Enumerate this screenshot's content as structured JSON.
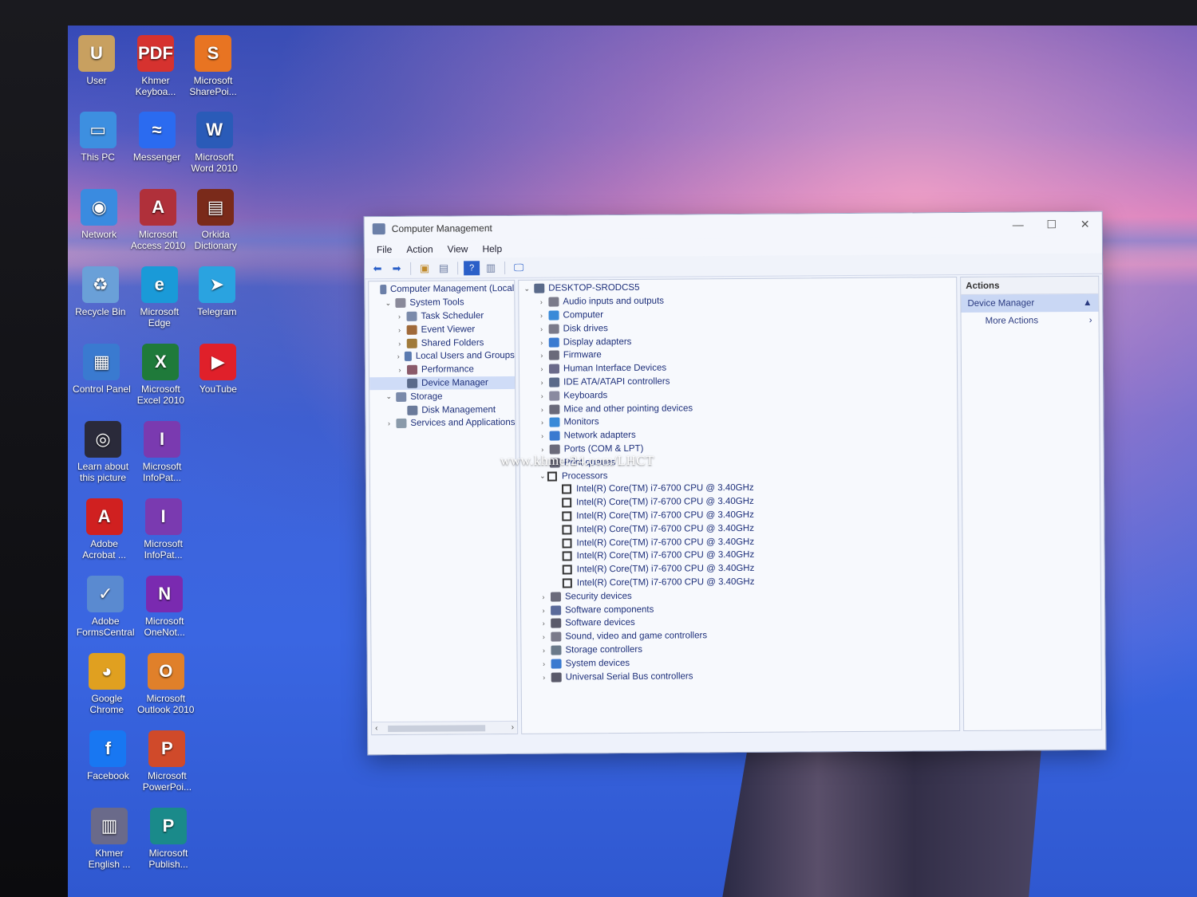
{
  "desktop_icons": [
    {
      "label": "User",
      "color": "#c8a060",
      "glyph": "U"
    },
    {
      "label": "Khmer Keyboa...",
      "color": "#d6322f",
      "glyph": "PDF"
    },
    {
      "label": "Microsoft SharePoi...",
      "color": "#e87422",
      "glyph": "S"
    },
    {
      "label": "This PC",
      "color": "#3d8fe0",
      "glyph": "▭"
    },
    {
      "label": "Messenger",
      "color": "#2b6bf0",
      "glyph": "≈"
    },
    {
      "label": "Microsoft Word 2010",
      "color": "#2a5bb8",
      "glyph": "W"
    },
    {
      "label": "Network",
      "color": "#3a8be0",
      "glyph": "◉"
    },
    {
      "label": "Microsoft Access 2010",
      "color": "#b0303a",
      "glyph": "A"
    },
    {
      "label": "Orkida Dictionary",
      "color": "#7a2a1a",
      "glyph": "▤"
    },
    {
      "label": "Recycle Bin",
      "color": "#6aa0d8",
      "glyph": "♻"
    },
    {
      "label": "Microsoft Edge",
      "color": "#1a9ad8",
      "glyph": "e"
    },
    {
      "label": "Telegram",
      "color": "#2aa3e0",
      "glyph": "➤"
    },
    {
      "label": "Control Panel",
      "color": "#3a7ad0",
      "glyph": "▦"
    },
    {
      "label": "Microsoft Excel 2010",
      "color": "#1f7a3a",
      "glyph": "X"
    },
    {
      "label": "YouTube",
      "color": "#e0202a",
      "glyph": "▶"
    },
    {
      "label": "Learn about this picture",
      "color": "#2a2a3a",
      "glyph": "◎"
    },
    {
      "label": "Microsoft InfoPat...",
      "color": "#7a3ab0",
      "glyph": "I"
    },
    {
      "label": "Adobe Acrobat ...",
      "color": "#d02020",
      "glyph": "A"
    },
    {
      "label": "Microsoft InfoPat...",
      "color": "#7a3ab0",
      "glyph": "I"
    },
    {
      "label": "Adobe FormsCentral",
      "color": "#5a8ad0",
      "glyph": "✓"
    },
    {
      "label": "Microsoft OneNot...",
      "color": "#7a2ab0",
      "glyph": "N"
    },
    {
      "label": "Google Chrome",
      "color": "#e0a020",
      "glyph": "◕"
    },
    {
      "label": "Microsoft Outlook 2010",
      "color": "#e0802a",
      "glyph": "O"
    },
    {
      "label": "Facebook",
      "color": "#1877f2",
      "glyph": "f"
    },
    {
      "label": "Microsoft PowerPoi...",
      "color": "#d04a2a",
      "glyph": "P"
    },
    {
      "label": "Khmer English ...",
      "color": "#6a6a8a",
      "glyph": "▥"
    },
    {
      "label": "Microsoft Publish...",
      "color": "#1a8a8a",
      "glyph": "P"
    }
  ],
  "window": {
    "title": "Computer Management",
    "controls": {
      "minimize": "—",
      "maximize": "☐",
      "close": "✕"
    },
    "menu": [
      "File",
      "Action",
      "View",
      "Help"
    ]
  },
  "left_tree": [
    {
      "label": "Computer Management (Local",
      "indent": 0,
      "chev": "",
      "color": "#6b7fa8"
    },
    {
      "label": "System Tools",
      "indent": 1,
      "chev": "v",
      "color": "#8a8a9a"
    },
    {
      "label": "Task Scheduler",
      "indent": 2,
      "chev": ">",
      "color": "#7a8aaa"
    },
    {
      "label": "Event Viewer",
      "indent": 2,
      "chev": ">",
      "color": "#a06a3a"
    },
    {
      "label": "Shared Folders",
      "indent": 2,
      "chev": ">",
      "color": "#a07a3a"
    },
    {
      "label": "Local Users and Groups",
      "indent": 2,
      "chev": ">",
      "color": "#5a7ab0"
    },
    {
      "label": "Performance",
      "indent": 2,
      "chev": ">",
      "color": "#8a5a6a"
    },
    {
      "label": "Device Manager",
      "indent": 2,
      "chev": "",
      "color": "#5a6a8a",
      "selected": true
    },
    {
      "label": "Storage",
      "indent": 1,
      "chev": "v",
      "color": "#7a8aaa"
    },
    {
      "label": "Disk Management",
      "indent": 2,
      "chev": "",
      "color": "#6a7a9a"
    },
    {
      "label": "Services and Applications",
      "indent": 1,
      "chev": ">",
      "color": "#8a9aaa"
    }
  ],
  "device_tree": {
    "root": "DESKTOP-SRODCS5",
    "categories_before": [
      {
        "label": "Audio inputs and outputs",
        "color": "#7a7a8a"
      },
      {
        "label": "Computer",
        "color": "#3a8ad8"
      },
      {
        "label": "Disk drives",
        "color": "#7a7a8a"
      },
      {
        "label": "Display adapters",
        "color": "#3a7ad0"
      },
      {
        "label": "Firmware",
        "color": "#6a6a7a"
      },
      {
        "label": "Human Interface Devices",
        "color": "#6a6a8a"
      },
      {
        "label": "IDE ATA/ATAPI controllers",
        "color": "#5a6a8a"
      },
      {
        "label": "Keyboards",
        "color": "#8a8aa0"
      },
      {
        "label": "Mice and other pointing devices",
        "color": "#6a6a7a"
      },
      {
        "label": "Monitors",
        "color": "#3a8ad8"
      },
      {
        "label": "Network adapters",
        "color": "#3a7ad0"
      },
      {
        "label": "Ports (COM & LPT)",
        "color": "#6a6a7a"
      },
      {
        "label": "Print queues",
        "color": "#6a6a7a"
      }
    ],
    "processors_label": "Processors",
    "processors": [
      "Intel(R) Core(TM) i7-6700 CPU @ 3.40GHz",
      "Intel(R) Core(TM) i7-6700 CPU @ 3.40GHz",
      "Intel(R) Core(TM) i7-6700 CPU @ 3.40GHz",
      "Intel(R) Core(TM) i7-6700 CPU @ 3.40GHz",
      "Intel(R) Core(TM) i7-6700 CPU @ 3.40GHz",
      "Intel(R) Core(TM) i7-6700 CPU @ 3.40GHz",
      "Intel(R) Core(TM) i7-6700 CPU @ 3.40GHz",
      "Intel(R) Core(TM) i7-6700 CPU @ 3.40GHz"
    ],
    "categories_after": [
      {
        "label": "Security devices",
        "color": "#6a6a7a"
      },
      {
        "label": "Software components",
        "color": "#5a6a9a"
      },
      {
        "label": "Software devices",
        "color": "#5a5a6a"
      },
      {
        "label": "Sound, video and game controllers",
        "color": "#7a7a8a"
      },
      {
        "label": "Storage controllers",
        "color": "#6a7a8a"
      },
      {
        "label": "System devices",
        "color": "#3a7ad0"
      },
      {
        "label": "Universal Serial Bus controllers",
        "color": "#5a5a6a"
      }
    ]
  },
  "actions": {
    "header": "Actions",
    "section": "Device Manager",
    "item": "More Actions"
  },
  "watermark": "www.khmer24.com/LHCT"
}
